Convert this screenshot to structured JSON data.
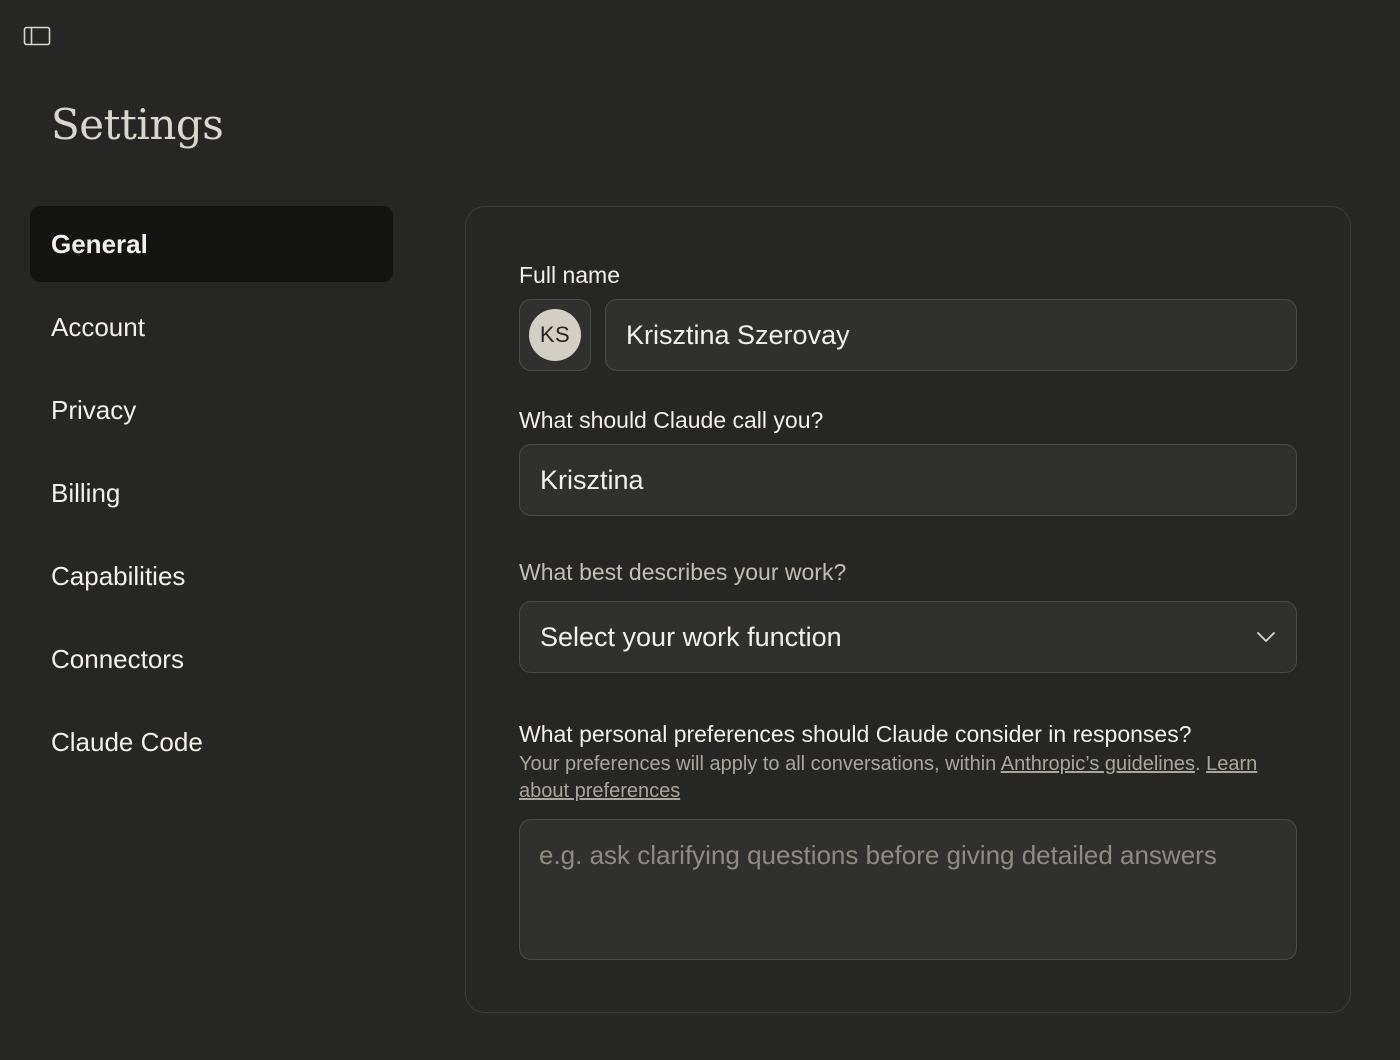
{
  "header": {
    "sidebar_toggle_icon": "sidebar-panel-icon",
    "title": "Settings"
  },
  "nav": {
    "items": [
      {
        "label": "General",
        "active": true
      },
      {
        "label": "Account",
        "active": false
      },
      {
        "label": "Privacy",
        "active": false
      },
      {
        "label": "Billing",
        "active": false
      },
      {
        "label": "Capabilities",
        "active": false
      },
      {
        "label": "Connectors",
        "active": false
      },
      {
        "label": "Claude Code",
        "active": false
      }
    ]
  },
  "general": {
    "full_name": {
      "label": "Full name",
      "avatar_initials": "KS",
      "value": "Krisztina Szerovay"
    },
    "nickname": {
      "label": "What should Claude call you?",
      "value": "Krisztina"
    },
    "work_function": {
      "label": "What best describes your work?",
      "selected": "Select your work function",
      "icon": "chevron-down-icon"
    },
    "preferences": {
      "label": "What personal preferences should Claude consider in responses?",
      "helper_prefix": "Your preferences will apply to all conversations, within ",
      "guidelines_link": "Anthropic’s guidelines",
      "helper_separator": ". ",
      "learn_link": "Learn about preferences",
      "placeholder": "e.g. ask clarifying questions before giving detailed answers"
    }
  },
  "colors": {
    "background": "#262624",
    "active_nav": "#141413",
    "field": "#30302e",
    "border": "#4a4a46",
    "text": "#f3f1ea",
    "muted_text": "#aaa69b"
  }
}
